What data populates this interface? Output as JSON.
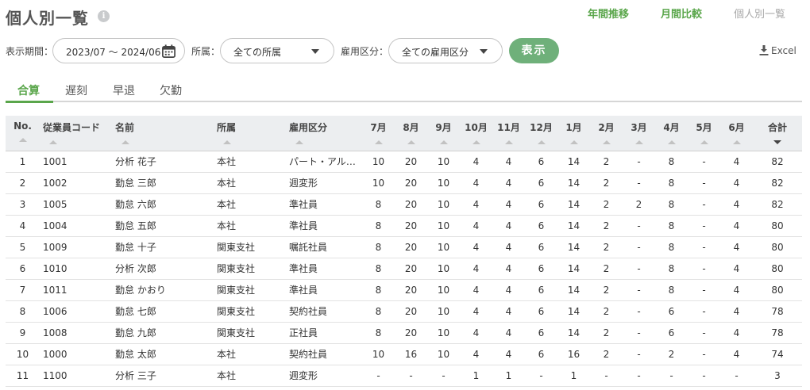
{
  "page": {
    "title": "個人別一覧",
    "info_icon": "info-icon"
  },
  "nav": {
    "annual": "年間推移",
    "monthly": "月間比較",
    "individual": "個人別一覧"
  },
  "filters": {
    "period_label": "表示期間：",
    "period_value": "2023/07 ～ 2024/06",
    "dept_label": "所属：",
    "dept_value": "全ての所属",
    "emp_label": "雇用区分：",
    "emp_value": "全ての雇用区分",
    "show_button": "表示",
    "excel_label": "Excel"
  },
  "tabs": [
    "合算",
    "遅刻",
    "早退",
    "欠勤"
  ],
  "active_tab": 0,
  "table": {
    "columns": [
      "No.",
      "従業員コード",
      "名前",
      "所属",
      "雇用区分",
      "7月",
      "8月",
      "9月",
      "10月",
      "11月",
      "12月",
      "1月",
      "2月",
      "3月",
      "4月",
      "5月",
      "6月",
      "合計"
    ],
    "rows": [
      [
        "1",
        "1001",
        "分析 花子",
        "本社",
        "パート・アルバイト",
        "10",
        "20",
        "10",
        "4",
        "4",
        "6",
        "14",
        "2",
        "-",
        "8",
        "-",
        "4",
        "82"
      ],
      [
        "2",
        "1002",
        "勤怠 三郎",
        "本社",
        "週変形",
        "10",
        "20",
        "10",
        "4",
        "4",
        "6",
        "14",
        "2",
        "-",
        "8",
        "-",
        "4",
        "82"
      ],
      [
        "3",
        "1005",
        "勤怠 六郎",
        "本社",
        "準社員",
        "8",
        "20",
        "10",
        "4",
        "4",
        "6",
        "14",
        "2",
        "2",
        "8",
        "-",
        "4",
        "82"
      ],
      [
        "4",
        "1004",
        "勤怠 五郎",
        "本社",
        "準社員",
        "8",
        "20",
        "10",
        "4",
        "4",
        "6",
        "14",
        "2",
        "-",
        "8",
        "-",
        "4",
        "80"
      ],
      [
        "5",
        "1009",
        "勤怠 十子",
        "関東支社",
        "嘱託社員",
        "8",
        "20",
        "10",
        "4",
        "4",
        "6",
        "14",
        "2",
        "-",
        "8",
        "-",
        "4",
        "80"
      ],
      [
        "6",
        "1010",
        "分析 次郎",
        "関東支社",
        "準社員",
        "8",
        "20",
        "10",
        "4",
        "4",
        "6",
        "14",
        "2",
        "-",
        "8",
        "-",
        "4",
        "80"
      ],
      [
        "7",
        "1011",
        "勤怠 かおり",
        "関東支社",
        "準社員",
        "8",
        "20",
        "10",
        "4",
        "4",
        "6",
        "14",
        "2",
        "-",
        "8",
        "-",
        "4",
        "80"
      ],
      [
        "8",
        "1006",
        "勤怠 七郎",
        "関東支社",
        "契約社員",
        "8",
        "20",
        "10",
        "4",
        "4",
        "6",
        "14",
        "2",
        "-",
        "6",
        "-",
        "4",
        "78"
      ],
      [
        "9",
        "1008",
        "勤怠 九郎",
        "関東支社",
        "正社員",
        "8",
        "20",
        "10",
        "4",
        "4",
        "6",
        "14",
        "2",
        "-",
        "6",
        "-",
        "4",
        "78"
      ],
      [
        "10",
        "1000",
        "勤怠 太郎",
        "本社",
        "契約社員",
        "10",
        "16",
        "10",
        "4",
        "4",
        "6",
        "16",
        "2",
        "-",
        "2",
        "-",
        "4",
        "74"
      ],
      [
        "11",
        "1100",
        "分析 三子",
        "本社",
        "週変形",
        "-",
        "-",
        "-",
        "1",
        "1",
        "-",
        "1",
        "-",
        "-",
        "-",
        "-",
        "-",
        "3"
      ]
    ]
  },
  "colors": {
    "accent": "#5aa64b",
    "button": "#6fb07a",
    "header_bg": "#eceef0"
  }
}
